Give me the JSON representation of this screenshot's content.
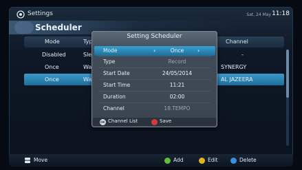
{
  "topbar": {
    "title": "Settings",
    "date": "Sat, 24 May",
    "time": "11:18"
  },
  "page": {
    "title": "Scheduler"
  },
  "table": {
    "headers": [
      "Mode",
      "Type",
      "Channel"
    ],
    "rows": [
      {
        "mode": "Disabled",
        "type": "Sleep",
        "channel": "-"
      },
      {
        "mode": "Once",
        "type": "Watch",
        "channel": "SYNERGY"
      },
      {
        "mode": "Once",
        "type": "Watch",
        "channel": "AL JAZEERA"
      }
    ]
  },
  "dialog": {
    "title": "Setting Scheduler",
    "fields": [
      {
        "label": "Mode",
        "value": "Once"
      },
      {
        "label": "Type",
        "value": "Record"
      },
      {
        "label": "Start Date",
        "value": "24/05/2014"
      },
      {
        "label": "Start Time",
        "value": "11:21"
      },
      {
        "label": "Duration",
        "value": "02:00"
      },
      {
        "label": "Channel",
        "value": "18.TEMPO"
      }
    ],
    "footer": {
      "ok_key": "OK",
      "channel_list": "Channel List",
      "save": "Save"
    }
  },
  "bottom": {
    "move": "Move",
    "add": "Add",
    "edit": "Edit",
    "delete": "Delete"
  },
  "colors": {
    "selection": "#2a8bbd",
    "green": "#5fbf3a",
    "yellow": "#e1b51e",
    "blue": "#3a8fe0",
    "red": "#d63b3b"
  },
  "icons": {
    "settings": "settings-icon",
    "move": "move-icon",
    "ok": "ok-key-icon"
  }
}
